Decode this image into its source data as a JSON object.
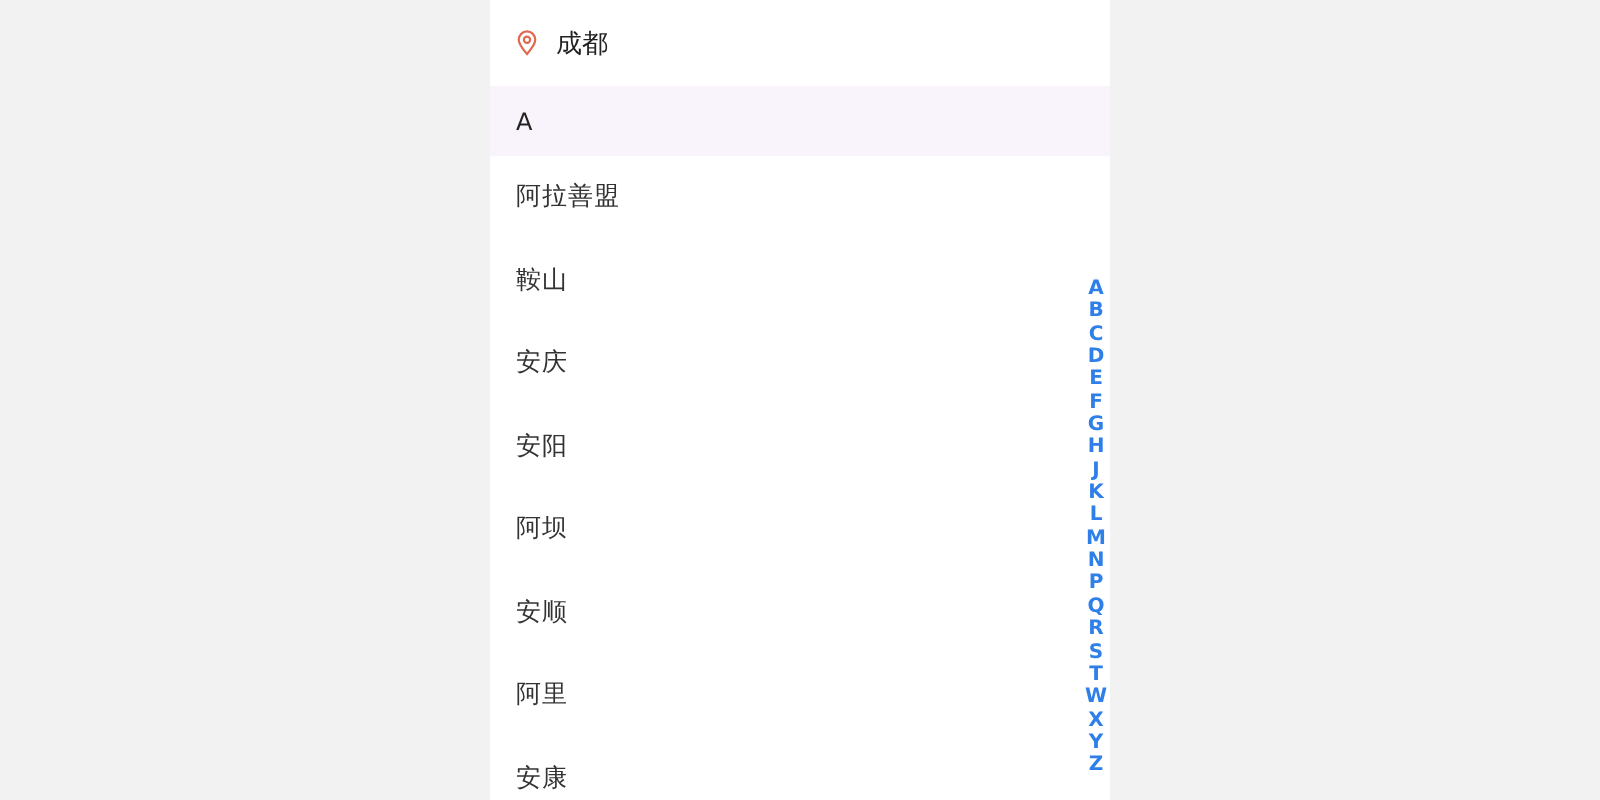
{
  "location": {
    "city": "成都"
  },
  "section": {
    "letter": "A"
  },
  "cities": [
    "阿拉善盟",
    "鞍山",
    "安庆",
    "安阳",
    "阿坝",
    "安顺",
    "阿里",
    "安康"
  ],
  "index": [
    "A",
    "B",
    "C",
    "D",
    "E",
    "F",
    "G",
    "H",
    "J",
    "K",
    "L",
    "M",
    "N",
    "P",
    "Q",
    "R",
    "S",
    "T",
    "W",
    "X",
    "Y",
    "Z"
  ]
}
